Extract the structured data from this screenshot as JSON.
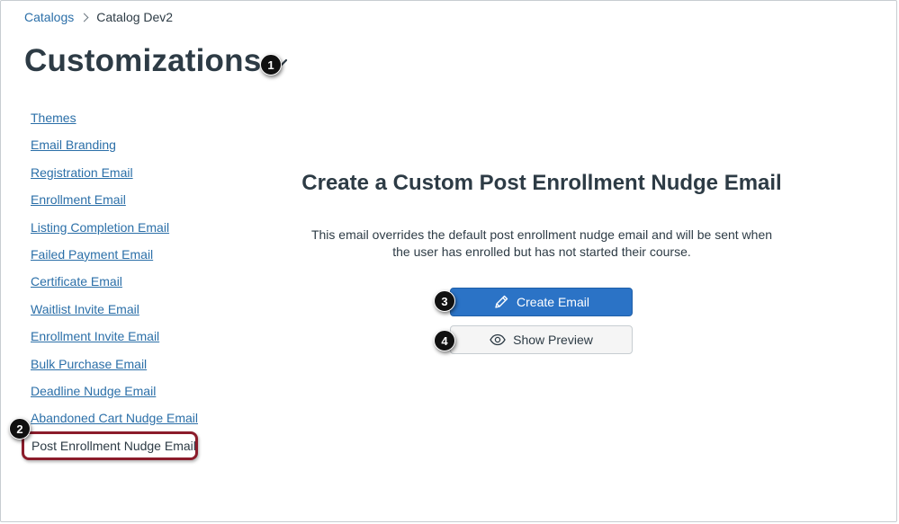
{
  "breadcrumb": {
    "root": "Catalogs",
    "current": "Catalog Dev2"
  },
  "header": {
    "title": "Customizations",
    "dropdown_icon": "chevron-down-icon"
  },
  "callouts": [
    "1",
    "2",
    "3",
    "4"
  ],
  "sidebar": {
    "items": [
      {
        "label": "Themes"
      },
      {
        "label": "Email Branding"
      },
      {
        "label": "Registration Email"
      },
      {
        "label": "Enrollment Email"
      },
      {
        "label": "Listing Completion Email"
      },
      {
        "label": "Failed Payment Email"
      },
      {
        "label": "Certificate Email"
      },
      {
        "label": "Waitlist Invite Email"
      },
      {
        "label": "Enrollment Invite Email"
      },
      {
        "label": "Bulk Purchase Email"
      },
      {
        "label": "Deadline Nudge Email"
      },
      {
        "label": "Abandoned Cart Nudge Email"
      }
    ],
    "active_item": "Post Enrollment Nudge Email"
  },
  "main": {
    "title": "Create a Custom Post Enrollment Nudge Email",
    "description": "This email overrides the default post enrollment nudge email and will be sent when the user has enrolled but has not started their course.",
    "create_button": {
      "label": "Create Email",
      "icon": "pencil-icon"
    },
    "preview_button": {
      "label": "Show Preview",
      "icon": "eye-icon"
    }
  },
  "colors": {
    "link": "#2b6fa8",
    "primary_button": "#2b73c6",
    "active_highlight": "#8b1c2b",
    "text": "#2d3b45"
  }
}
